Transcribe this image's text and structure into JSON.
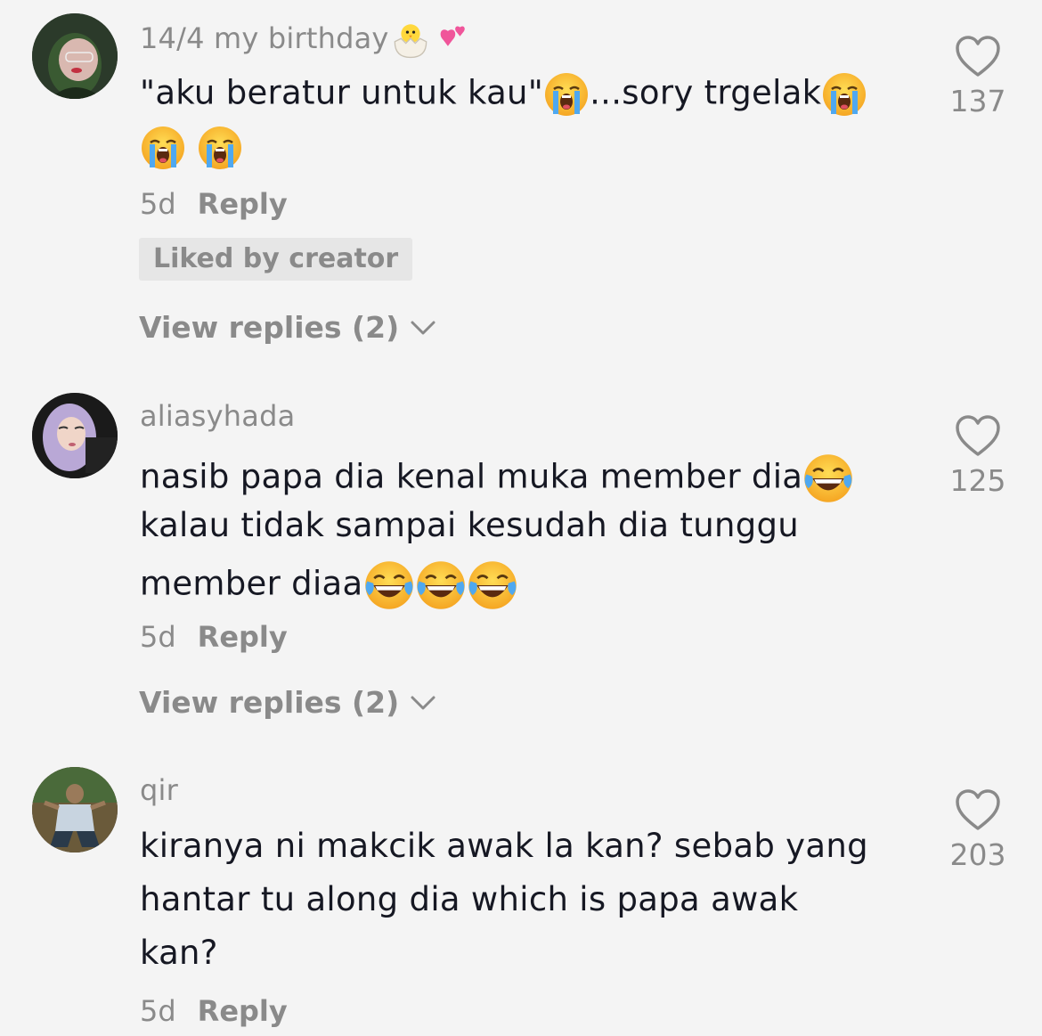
{
  "comments": [
    {
      "username": "14/4 my birthday",
      "username_emojis": [
        "hatching-chick-emoji",
        "two-hearts-emoji"
      ],
      "lines": [
        {
          "text_a": "\"aku beratur untuk kau\"",
          "emoji_a": "loudly-crying-emoji",
          "text_b": "...sory trgelak",
          "emoji_b": "loudly-crying-emoji"
        },
        {
          "emojis": [
            "loudly-crying-emoji",
            "loudly-crying-emoji"
          ]
        }
      ],
      "time": "5d",
      "reply_label": "Reply",
      "liked_badge": "Liked by creator",
      "view_replies": "View replies (2)",
      "like_count": "137",
      "avatar": "avatar-green-hijab"
    },
    {
      "username": "aliasyhada",
      "lines": [
        {
          "text": "nasib papa dia kenal muka member dia",
          "emojis": [
            "tears-of-joy-emoji"
          ]
        },
        {
          "text": "kalau tidak sampai kesudah dia tunggu"
        },
        {
          "text": "member diaa",
          "emojis": [
            "tears-of-joy-emoji",
            "tears-of-joy-emoji",
            "tears-of-joy-emoji"
          ]
        }
      ],
      "time": "5d",
      "reply_label": "Reply",
      "view_replies": "View replies (2)",
      "like_count": "125",
      "avatar": "avatar-purple-hijab"
    },
    {
      "username": "qir",
      "lines": [
        {
          "text": "kiranya ni makcik awak la kan? sebab yang"
        },
        {
          "text": "hantar tu along dia which is papa awak"
        },
        {
          "text": "kan?"
        }
      ],
      "time": "5d",
      "reply_label": "Reply",
      "like_count": "203",
      "avatar": "avatar-person-outdoor"
    }
  ],
  "colors": {
    "background": "#f4f4f4",
    "text_primary": "#161823",
    "text_secondary": "#8a8a8a",
    "badge_bg": "#e6e6e6"
  },
  "icons": {
    "like": "heart-outline-icon",
    "expand": "chevron-down-icon"
  }
}
